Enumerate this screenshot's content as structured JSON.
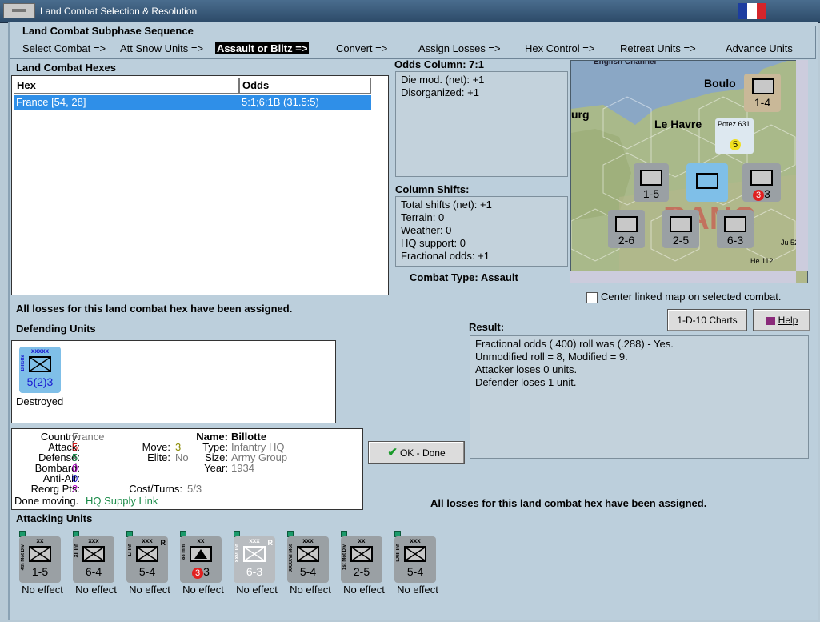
{
  "window": {
    "title": "Land Combat Selection & Resolution"
  },
  "sequence": {
    "title": "Land Combat Subphase Sequence",
    "steps": [
      "Select Combat =>",
      "Att Snow Units =>",
      "Assault or Blitz =>",
      "Convert =>",
      "Assign Losses =>",
      "Hex Control =>",
      "Retreat Units =>",
      "Advance Units"
    ],
    "active_index": 2
  },
  "hexes": {
    "title": "Land Combat Hexes",
    "columns": [
      "Hex",
      "Odds"
    ],
    "rows": [
      {
        "hex": "France [54, 28]",
        "odds": "5:1;6:1B (31.5:5)"
      }
    ]
  },
  "odds": {
    "title": "Odds Column: 7:1",
    "lines": [
      "Die mod. (net): +1",
      "Disorganized: +1"
    ]
  },
  "shifts": {
    "title": "Column Shifts:",
    "lines": [
      "Total shifts (net): +1",
      "Terrain: 0",
      "Weather: 0",
      "HQ support: 0",
      "Fractional odds: +1"
    ]
  },
  "combat_type": "Combat Type:  Assault",
  "losses_msg_top": "All losses for this land combat hex have been assigned.",
  "losses_msg_bottom": "All losses for this land combat hex have been assigned.",
  "map": {
    "labels": [
      "English Channel",
      "Boulo",
      "urg",
      "Le Havre",
      "Potez 631",
      "He 112",
      "Ju 52"
    ],
    "center_checkbox_label": "Center linked map on selected combat.",
    "center_checked": false
  },
  "buttons": {
    "charts": "1-D-10 Charts",
    "help": "Help",
    "ok": "OK - Done"
  },
  "result": {
    "title": "Result:",
    "lines": [
      "Fractional odds (.400) roll was (.288)  - Yes.",
      "Unmodified roll = 8, Modified = 9.",
      "Attacker loses 0 units.",
      "Defender loses 1 unit."
    ]
  },
  "defending": {
    "title": "Defending Units",
    "unit": {
      "side_label": "Billotte",
      "size": "xxxxx",
      "stats": "5(2)3",
      "status": "Destroyed"
    }
  },
  "info": {
    "country_label": "Country:",
    "country": "France",
    "attack_label": "Attack:",
    "attack": "5",
    "defense_label": "Defense:",
    "defense": "5",
    "bombard_label": "Bombard:",
    "bombard": "0",
    "antiair_label": "Anti-Air:",
    "antiair": "0",
    "reorg_label": "Reorg Pts:",
    "reorg": "2",
    "move_label": "Move:",
    "move": "3",
    "elite_label": "Elite:",
    "elite": "No",
    "cost_label": "Cost/Turns:",
    "cost": "5/3",
    "name_label": "Name:",
    "name": "Billotte",
    "type_label": "Type:",
    "type": "Infantry HQ",
    "size_label": "Size:",
    "size": "Army Group",
    "year_label": "Year:",
    "year": "1934",
    "done_text": "Done moving.",
    "supply": "HQ Supply Link"
  },
  "attacking": {
    "title": "Attacking Units",
    "units": [
      {
        "side": "4th Mot Div",
        "size": "xx",
        "stats": "1-5",
        "effect": "No effect",
        "badge": ""
      },
      {
        "side": "XII Inf",
        "size": "xxx",
        "stats": "6-4",
        "effect": "No effect",
        "badge": ""
      },
      {
        "side": "LI Inf",
        "size": "xxx",
        "stats": "5-4",
        "effect": "No effect",
        "badge": "R"
      },
      {
        "side": "88 mm",
        "size": "xx",
        "stats": "3",
        "effect": "No effect",
        "badge": "",
        "red": "3"
      },
      {
        "side": "XXVI Inf",
        "size": "xxx",
        "stats": "6-3",
        "effect": "No effect",
        "badge": "R"
      },
      {
        "side": "XXXXVI Mot",
        "size": "xxx",
        "stats": "5-4",
        "effect": "No effect",
        "badge": ""
      },
      {
        "side": "1st Mot Div",
        "size": "xx",
        "stats": "2-5",
        "effect": "No effect",
        "badge": ""
      },
      {
        "side": "LXIII Inf",
        "size": "xxx",
        "stats": "5-4",
        "effect": "No effect",
        "badge": ""
      }
    ]
  },
  "colors": {
    "selected_row": "#2f8fe8",
    "panel": "#bccfdc",
    "active_step_bg": "#000000"
  }
}
